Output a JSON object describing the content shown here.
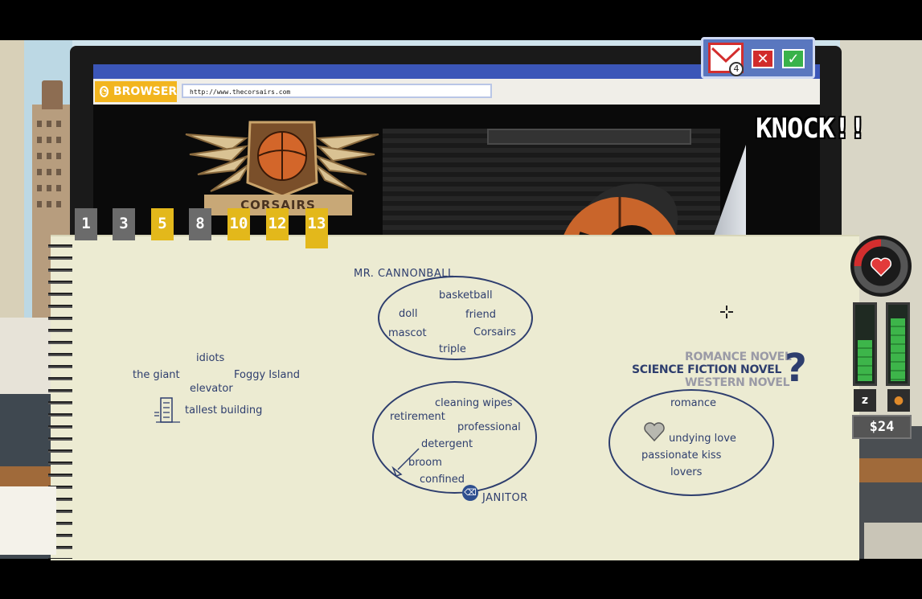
{
  "browser": {
    "label": "BROWSER",
    "url": "http://www.thecorsairs.com",
    "site_banner": "CORSAIRS"
  },
  "mail": {
    "unread_count": "4",
    "reject_symbol": "✕",
    "accept_symbol": "✓"
  },
  "event_text": "KNOCK!!",
  "tabs": [
    {
      "label": "1",
      "style": "gray"
    },
    {
      "label": "3",
      "style": "gray"
    },
    {
      "label": "5",
      "style": "yellow"
    },
    {
      "label": "8",
      "style": "gray"
    },
    {
      "label": "10",
      "style": "yellow"
    },
    {
      "label": "12",
      "style": "yellow"
    },
    {
      "label": "13",
      "style": "yellow"
    }
  ],
  "notebook": {
    "cannonball": {
      "title": "MR. CANNONBALL",
      "words": [
        "basketball",
        "doll",
        "friend",
        "mascot",
        "Corsairs",
        "triple"
      ]
    },
    "giant": {
      "words": [
        "idiots",
        "the giant",
        "Foggy Island",
        "elevator",
        "tallest building"
      ]
    },
    "janitor": {
      "title": "JANITOR",
      "words": [
        "cleaning wipes",
        "retirement",
        "professional",
        "detergent",
        "broom",
        "confined"
      ]
    },
    "novel": {
      "options": [
        "ROMANCE NOVEL",
        "SCIENCE FICTION NOVEL",
        "WESTERN NOVEL"
      ],
      "selected_index": 1,
      "question_mark": "?",
      "words": [
        "romance",
        "undying love",
        "passionate kiss",
        "lovers"
      ]
    }
  },
  "hud": {
    "money": "$24",
    "sleep_meter_level": 0.55,
    "food_meter_level": 0.85,
    "sleep_icon": "zzz-icon",
    "food_icon": "drumstick-icon",
    "health_icon": "heart-icon"
  },
  "colors": {
    "ink": "#2e3e6e",
    "tab_yellow": "#e3b81b",
    "tab_gray": "#6b6b6b",
    "browser_accent": "#f2b51f",
    "meter_green": "#3db54a",
    "ring_red": "#d32e2e"
  }
}
